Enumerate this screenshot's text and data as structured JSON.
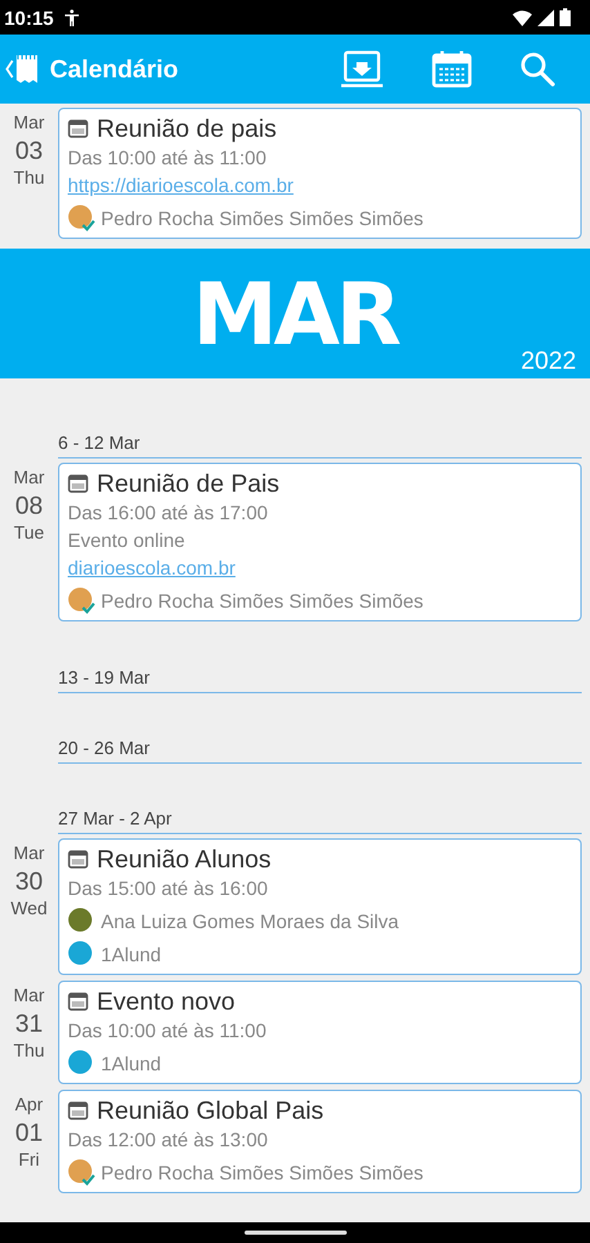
{
  "status_bar": {
    "time": "10:15"
  },
  "app_bar": {
    "title": "Calendário"
  },
  "items": [
    {
      "kind": "event",
      "date": {
        "month": "Mar",
        "day": "03",
        "weekday": "Thu"
      },
      "title": "Reunião de pais",
      "details": [
        {
          "kind": "text",
          "text": "Das 10:00 até às 11:00"
        },
        {
          "kind": "link",
          "text": "https://diarioescola.com.br"
        }
      ],
      "attendees": [
        {
          "name": "Pedro Rocha Simões Simões Simões",
          "color": "#e0a050",
          "verified": true
        }
      ]
    },
    {
      "kind": "month_banner",
      "month": "MAR",
      "year": "2022"
    },
    {
      "kind": "week",
      "label": "6 - 12 Mar"
    },
    {
      "kind": "event",
      "date": {
        "month": "Mar",
        "day": "08",
        "weekday": "Tue"
      },
      "title": "Reunião de Pais",
      "details": [
        {
          "kind": "text",
          "text": "Das 16:00 até às 17:00"
        },
        {
          "kind": "text",
          "text": "Evento online"
        },
        {
          "kind": "link",
          "text": "diarioescola.com.br"
        }
      ],
      "attendees": [
        {
          "name": "Pedro Rocha Simões Simões Simões",
          "color": "#e0a050",
          "verified": true
        }
      ]
    },
    {
      "kind": "week",
      "label": "13 - 19 Mar"
    },
    {
      "kind": "week",
      "label": "20 - 26 Mar"
    },
    {
      "kind": "week",
      "label": "27 Mar - 2 Apr"
    },
    {
      "kind": "event",
      "date": {
        "month": "Mar",
        "day": "30",
        "weekday": "Wed"
      },
      "title": "Reunião Alunos",
      "details": [
        {
          "kind": "text",
          "text": "Das 15:00 até às 16:00"
        }
      ],
      "attendees": [
        {
          "name": "Ana Luiza Gomes Moraes da Silva",
          "color": "#6b7a2a",
          "verified": false
        },
        {
          "name": "1Alund",
          "color": "#1aa7d6",
          "verified": false
        }
      ]
    },
    {
      "kind": "event",
      "date": {
        "month": "Mar",
        "day": "31",
        "weekday": "Thu"
      },
      "title": "Evento novo",
      "details": [
        {
          "kind": "text",
          "text": "Das 10:00 até às 11:00"
        }
      ],
      "attendees": [
        {
          "name": "1Alund",
          "color": "#1aa7d6",
          "verified": false
        }
      ]
    },
    {
      "kind": "event",
      "date": {
        "month": "Apr",
        "day": "01",
        "weekday": "Fri"
      },
      "title": "Reunião Global Pais",
      "details": [
        {
          "kind": "text",
          "text": "Das 12:00 até às 13:00"
        }
      ],
      "attendees": [
        {
          "name": "Pedro Rocha Simões Simões Simões",
          "color": "#e0a050",
          "verified": true
        }
      ]
    }
  ]
}
